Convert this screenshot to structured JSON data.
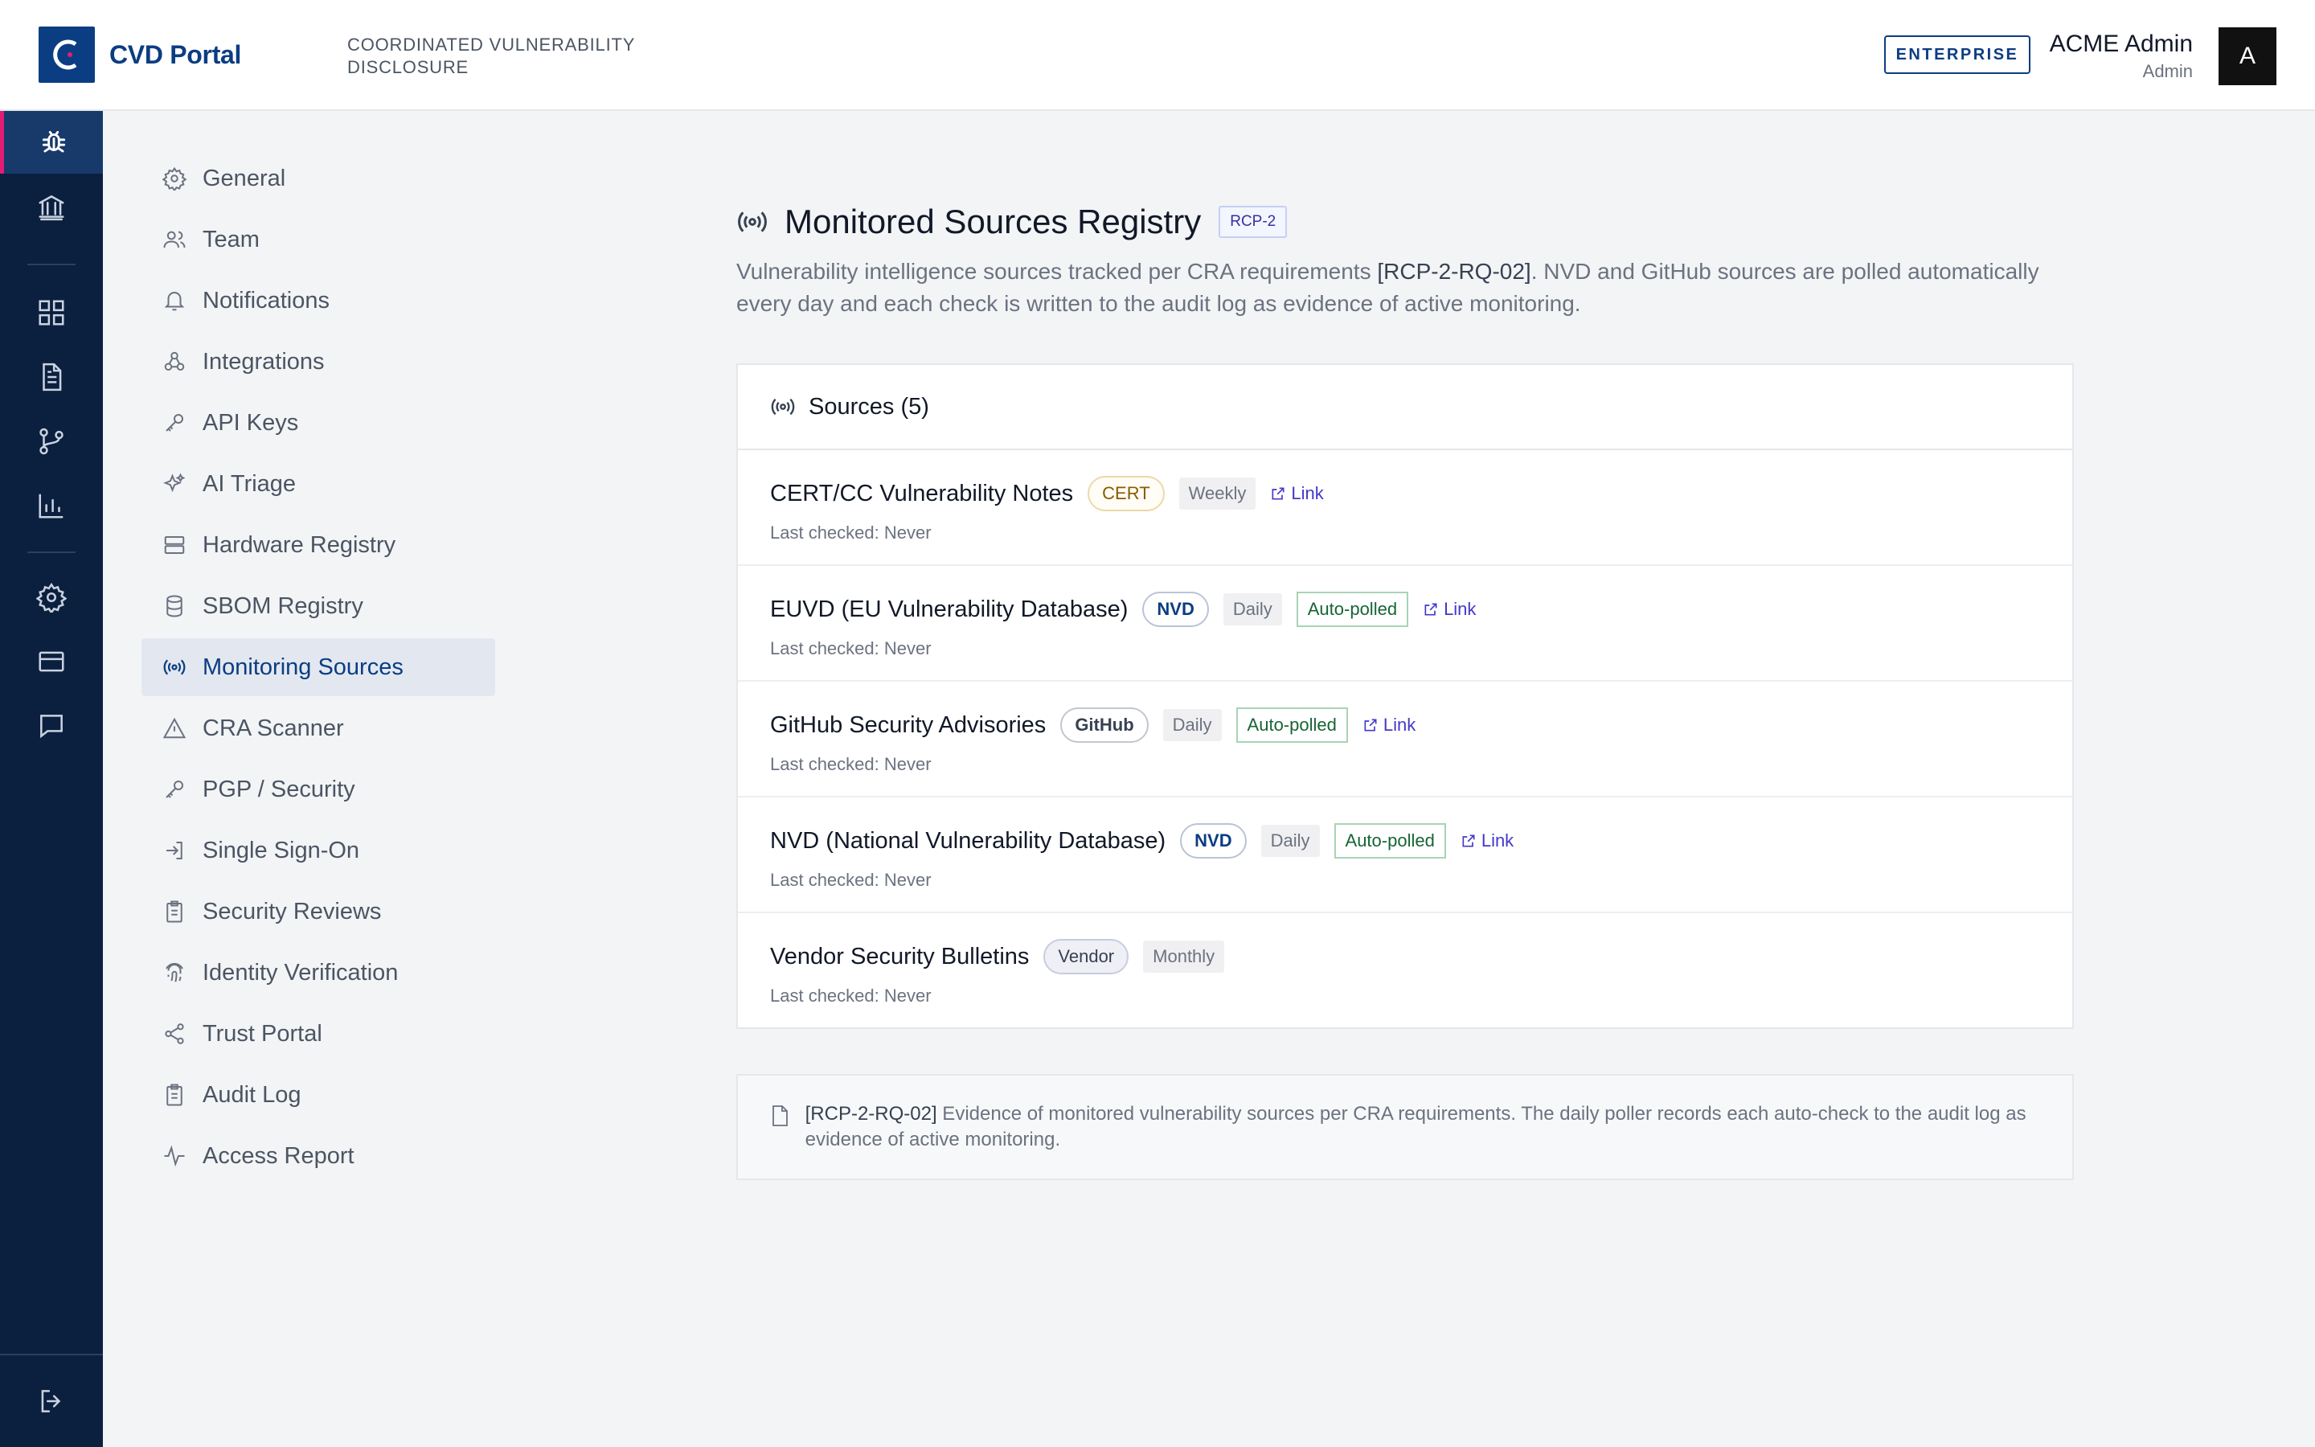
{
  "header": {
    "brand": "CVD Portal",
    "tagline": "COORDINATED VULNERABILITY DISCLOSURE",
    "plan": "ENTERPRISE",
    "user_name": "ACME Admin",
    "user_role": "Admin",
    "avatar_initial": "A",
    "colors": {
      "brand": "#0b3d82",
      "accent": "#e11d74"
    }
  },
  "rail": {
    "items": [
      "bug-icon",
      "bank-icon",
      "dashboard-icon",
      "document-icon",
      "git-branch-icon",
      "chart-icon",
      "gear-icon",
      "credit-card-icon",
      "message-icon"
    ],
    "active": "bug-icon",
    "bottom": "logout-icon"
  },
  "settings_nav": {
    "items": [
      {
        "label": "General",
        "icon": "gear-icon"
      },
      {
        "label": "Team",
        "icon": "users-icon"
      },
      {
        "label": "Notifications",
        "icon": "bell-icon"
      },
      {
        "label": "Integrations",
        "icon": "webhook-icon"
      },
      {
        "label": "API Keys",
        "icon": "key-icon"
      },
      {
        "label": "AI Triage",
        "icon": "sparkles-icon"
      },
      {
        "label": "Hardware Registry",
        "icon": "server-icon"
      },
      {
        "label": "SBOM Registry",
        "icon": "database-icon"
      },
      {
        "label": "Monitoring Sources",
        "icon": "radio-icon"
      },
      {
        "label": "CRA Scanner",
        "icon": "warning-icon"
      },
      {
        "label": "PGP / Security",
        "icon": "key-icon"
      },
      {
        "label": "Single Sign-On",
        "icon": "login-icon"
      },
      {
        "label": "Security Reviews",
        "icon": "clipboard-icon"
      },
      {
        "label": "Identity Verification",
        "icon": "fingerprint-icon"
      },
      {
        "label": "Trust Portal",
        "icon": "share-icon"
      },
      {
        "label": "Audit Log",
        "icon": "clipboard-icon"
      },
      {
        "label": "Access Report",
        "icon": "activity-icon"
      }
    ],
    "active": "Monitoring Sources"
  },
  "page": {
    "title": "Monitored Sources Registry",
    "badge": "RCP-2",
    "desc_ref": "[RCP-2-RQ-02]",
    "desc_before": "Vulnerability intelligence sources tracked per CRA requirements ",
    "desc_after": ". NVD and GitHub sources are polled automatically every day and each check is written to the audit log as evidence of active monitoring."
  },
  "sources_panel": {
    "title": "Sources (5)",
    "link_label": "Link",
    "auto_label": "Auto-polled",
    "last_checked_label": "Last checked: Never",
    "rows": [
      {
        "name": "CERT/CC Vulnerability Notes",
        "type": "CERT",
        "frequency": "Weekly",
        "auto": false,
        "link": true
      },
      {
        "name": "EUVD (EU Vulnerability Database)",
        "type": "NVD",
        "frequency": "Daily",
        "auto": true,
        "link": true
      },
      {
        "name": "GitHub Security Advisories",
        "type": "GitHub",
        "frequency": "Daily",
        "auto": true,
        "link": true
      },
      {
        "name": "NVD (National Vulnerability Database)",
        "type": "NVD",
        "frequency": "Daily",
        "auto": true,
        "link": true
      },
      {
        "name": "Vendor Security Bulletins",
        "type": "Vendor",
        "frequency": "Monthly",
        "auto": false,
        "link": false
      }
    ]
  },
  "note": {
    "ref": "[RCP-2-RQ-02]",
    "text": " Evidence of monitored vulnerability sources per CRA requirements. The daily poller records each auto-check to the audit log as evidence of active monitoring."
  }
}
